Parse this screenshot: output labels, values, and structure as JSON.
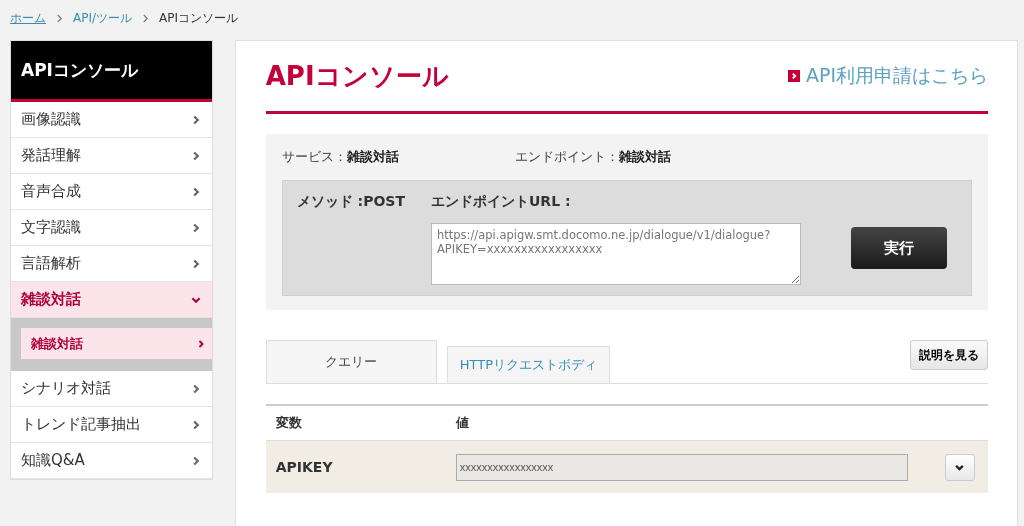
{
  "breadcrumb": [
    {
      "label": "ホーム",
      "kind": "link"
    },
    {
      "label": "API/ツール",
      "kind": "link"
    },
    {
      "label": "APIコンソール",
      "kind": "current"
    }
  ],
  "sidebar": {
    "title": "APIコンソール",
    "items": [
      {
        "label": "画像認識",
        "selected": false,
        "expanded": false
      },
      {
        "label": "発話理解",
        "selected": false,
        "expanded": false
      },
      {
        "label": "音声合成",
        "selected": false,
        "expanded": false
      },
      {
        "label": "文字認識",
        "selected": false,
        "expanded": false
      },
      {
        "label": "言語解析",
        "selected": false,
        "expanded": false
      },
      {
        "label": "雑談対話",
        "selected": true,
        "expanded": true,
        "children": [
          {
            "label": "雑談対話",
            "selected": true
          }
        ]
      },
      {
        "label": "シナリオ対話",
        "selected": false,
        "expanded": false
      },
      {
        "label": "トレンド記事抽出",
        "selected": false,
        "expanded": false
      },
      {
        "label": "知識Q&A",
        "selected": false,
        "expanded": false
      }
    ]
  },
  "main": {
    "title": "APIコンソール",
    "apply_link": "API利用申請はこちら",
    "service_label": "サービス：",
    "service_value": "雑談対話",
    "endpoint_label": "エンドポイント：",
    "endpoint_value": "雑談対話",
    "method": "メソッド :POST",
    "endpoint_url_label": "エンドポイントURL :",
    "endpoint_url": "https://api.apigw.smt.docomo.ne.jp/dialogue/v1/dialogue?APIKEY=xxxxxxxxxxxxxxxxx",
    "run_button": "実行",
    "tabs": [
      {
        "label": "クエリー",
        "selected": true
      },
      {
        "label": "HTTPリクエストボディ",
        "selected": false
      }
    ],
    "help_button": "説明を見る",
    "table": {
      "columns": [
        "変数",
        "値"
      ],
      "rows": [
        {
          "name": "APIKEY",
          "value": "xxxxxxxxxxxxxxxxx"
        }
      ]
    }
  }
}
